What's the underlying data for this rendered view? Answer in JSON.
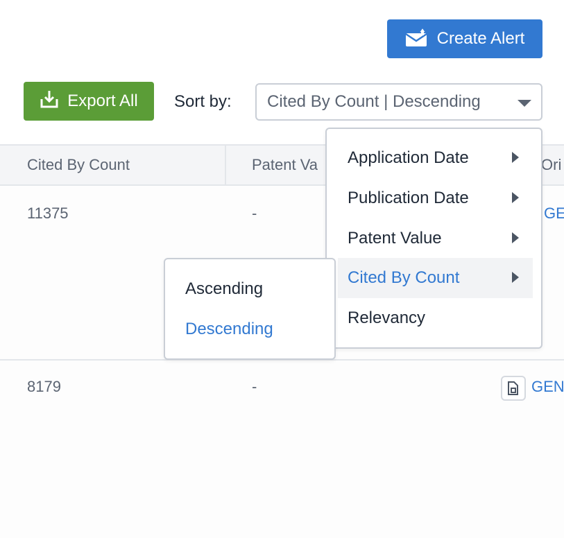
{
  "toolbar": {
    "create_alert_label": "Create Alert",
    "export_all_label": "Export All",
    "sort_by_label": "Sort by:",
    "sort_value": "Cited By Count | Descending"
  },
  "table": {
    "columns": [
      "Cited By Count",
      "Patent Va",
      "Ori"
    ],
    "rows": [
      {
        "cited_by_count": "11375",
        "patent_value": "-",
        "origin": "GEN"
      },
      {
        "cited_by_count": "8179",
        "patent_value": "-",
        "origin": "GEN"
      }
    ]
  },
  "sort_menu": {
    "items": [
      {
        "label": "Application Date",
        "has_submenu": true
      },
      {
        "label": "Publication Date",
        "has_submenu": true
      },
      {
        "label": "Patent Value",
        "has_submenu": true
      },
      {
        "label": "Cited By Count",
        "has_submenu": true,
        "active": true
      },
      {
        "label": "Relevancy",
        "has_submenu": false
      }
    ],
    "submenu": {
      "items": [
        {
          "label": "Ascending"
        },
        {
          "label": "Descending",
          "active": true
        }
      ]
    }
  },
  "icons": {
    "create_alert": "mail-alert-icon",
    "export_all": "download-icon",
    "sort_select": "caret-down-icon",
    "menu_arrow": "caret-right-icon",
    "row_document": "document-icon"
  },
  "colors": {
    "primary_blue": "#3279d1",
    "export_green": "#5b9d37",
    "text_dark": "#1f2937",
    "text_muted": "#5b6472",
    "border": "#c9ced6",
    "header_bg": "#f4f5f7",
    "active_item_bg": "#f2f3f5"
  }
}
